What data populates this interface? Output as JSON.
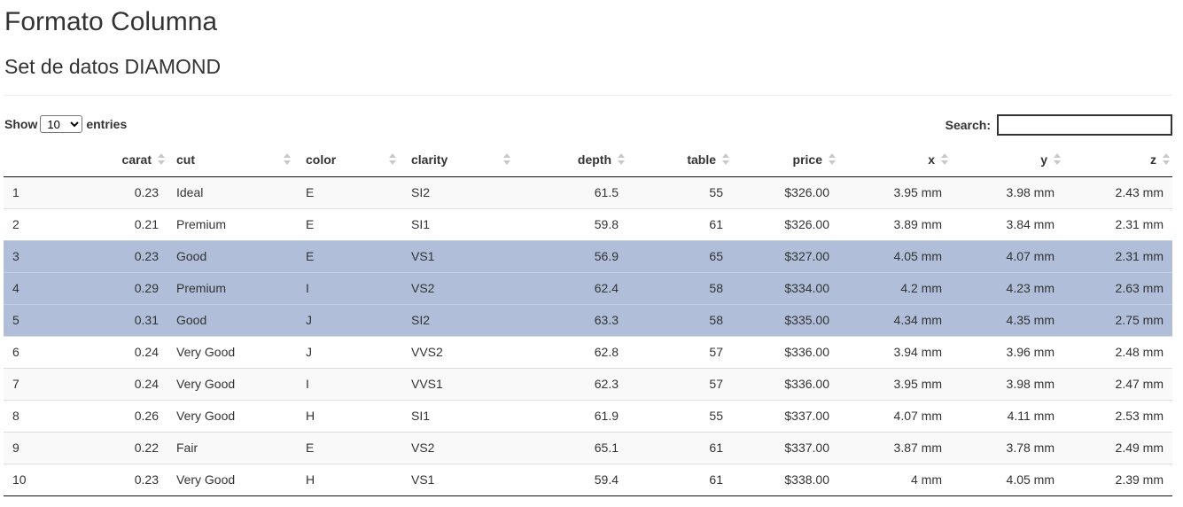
{
  "page": {
    "title": "Formato Columna",
    "subtitle": "Set de datos DIAMOND"
  },
  "controls": {
    "show_label": "Show",
    "entries_label": "entries",
    "page_length": "10",
    "page_length_options": [
      "10"
    ],
    "search_label": "Search:",
    "search_value": ""
  },
  "table": {
    "columns": [
      "",
      "carat",
      "cut",
      "color",
      "clarity",
      "depth",
      "table",
      "price",
      "x",
      "y",
      "z"
    ],
    "rows": [
      {
        "id": "1",
        "carat": "0.23",
        "cut": "Ideal",
        "color": "E",
        "clarity": "SI2",
        "depth": "61.5",
        "table": "55",
        "price": "$326.00",
        "x": "3.95 mm",
        "y": "3.98 mm",
        "z": "2.43 mm",
        "selected": false
      },
      {
        "id": "2",
        "carat": "0.21",
        "cut": "Premium",
        "color": "E",
        "clarity": "SI1",
        "depth": "59.8",
        "table": "61",
        "price": "$326.00",
        "x": "3.89 mm",
        "y": "3.84 mm",
        "z": "2.31 mm",
        "selected": false
      },
      {
        "id": "3",
        "carat": "0.23",
        "cut": "Good",
        "color": "E",
        "clarity": "VS1",
        "depth": "56.9",
        "table": "65",
        "price": "$327.00",
        "x": "4.05 mm",
        "y": "4.07 mm",
        "z": "2.31 mm",
        "selected": true
      },
      {
        "id": "4",
        "carat": "0.29",
        "cut": "Premium",
        "color": "I",
        "clarity": "VS2",
        "depth": "62.4",
        "table": "58",
        "price": "$334.00",
        "x": "4.2 mm",
        "y": "4.23 mm",
        "z": "2.63 mm",
        "selected": true
      },
      {
        "id": "5",
        "carat": "0.31",
        "cut": "Good",
        "color": "J",
        "clarity": "SI2",
        "depth": "63.3",
        "table": "58",
        "price": "$335.00",
        "x": "4.34 mm",
        "y": "4.35 mm",
        "z": "2.75 mm",
        "selected": true
      },
      {
        "id": "6",
        "carat": "0.24",
        "cut": "Very Good",
        "color": "J",
        "clarity": "VVS2",
        "depth": "62.8",
        "table": "57",
        "price": "$336.00",
        "x": "3.94 mm",
        "y": "3.96 mm",
        "z": "2.48 mm",
        "selected": false
      },
      {
        "id": "7",
        "carat": "0.24",
        "cut": "Very Good",
        "color": "I",
        "clarity": "VVS1",
        "depth": "62.3",
        "table": "57",
        "price": "$336.00",
        "x": "3.95 mm",
        "y": "3.98 mm",
        "z": "2.47 mm",
        "selected": false
      },
      {
        "id": "8",
        "carat": "0.26",
        "cut": "Very Good",
        "color": "H",
        "clarity": "SI1",
        "depth": "61.9",
        "table": "55",
        "price": "$337.00",
        "x": "4.07 mm",
        "y": "4.11 mm",
        "z": "2.53 mm",
        "selected": false
      },
      {
        "id": "9",
        "carat": "0.22",
        "cut": "Fair",
        "color": "E",
        "clarity": "VS2",
        "depth": "65.1",
        "table": "61",
        "price": "$337.00",
        "x": "3.87 mm",
        "y": "3.78 mm",
        "z": "2.49 mm",
        "selected": false
      },
      {
        "id": "10",
        "carat": "0.23",
        "cut": "Very Good",
        "color": "H",
        "clarity": "VS1",
        "depth": "59.4",
        "table": "61",
        "price": "$338.00",
        "x": "4 mm",
        "y": "4.05 mm",
        "z": "2.39 mm",
        "selected": false
      }
    ]
  },
  "colors": {
    "selected_row": "#b0bed9",
    "odd_row": "#f9f9f9",
    "text": "#333333"
  },
  "icons": {
    "sort": "sort-both-icon"
  }
}
